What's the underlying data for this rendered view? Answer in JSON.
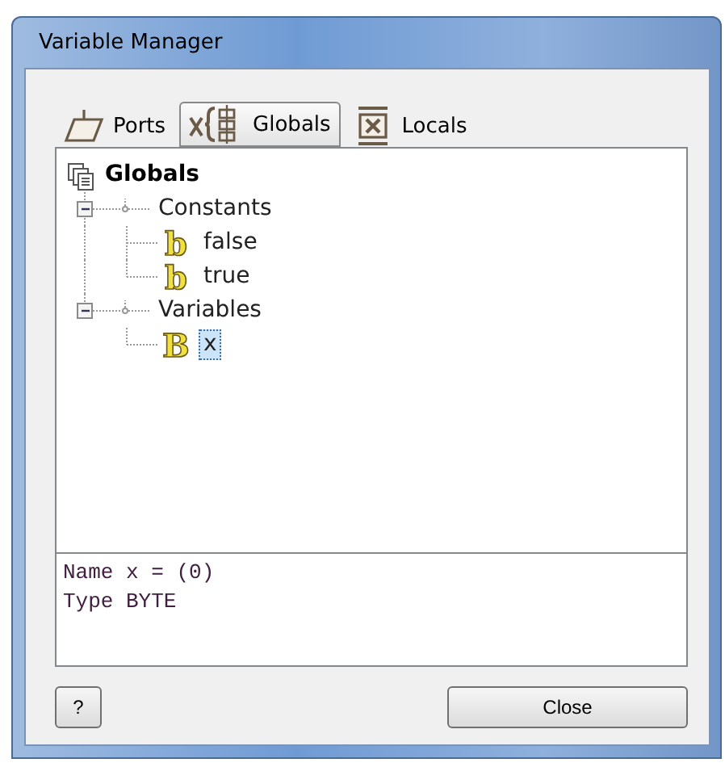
{
  "window": {
    "title": "Variable Manager"
  },
  "tabs": [
    {
      "label": "Ports",
      "selected": false
    },
    {
      "label": "Globals",
      "selected": true
    },
    {
      "label": "Locals",
      "selected": false
    }
  ],
  "tree": {
    "label": "Globals",
    "children": [
      {
        "label": "Constants",
        "expanded": true,
        "selected": false,
        "children": [
          {
            "label": "false",
            "icon": "b",
            "selected": false
          },
          {
            "label": "true",
            "icon": "b",
            "selected": false
          }
        ]
      },
      {
        "label": "Variables",
        "expanded": true,
        "selected": false,
        "children": [
          {
            "label": "x",
            "icon": "B",
            "selected": true
          }
        ]
      }
    ]
  },
  "info": [
    "Name x = (0)",
    "Type BYTE"
  ],
  "buttons": {
    "help": "?",
    "close": "Close"
  }
}
